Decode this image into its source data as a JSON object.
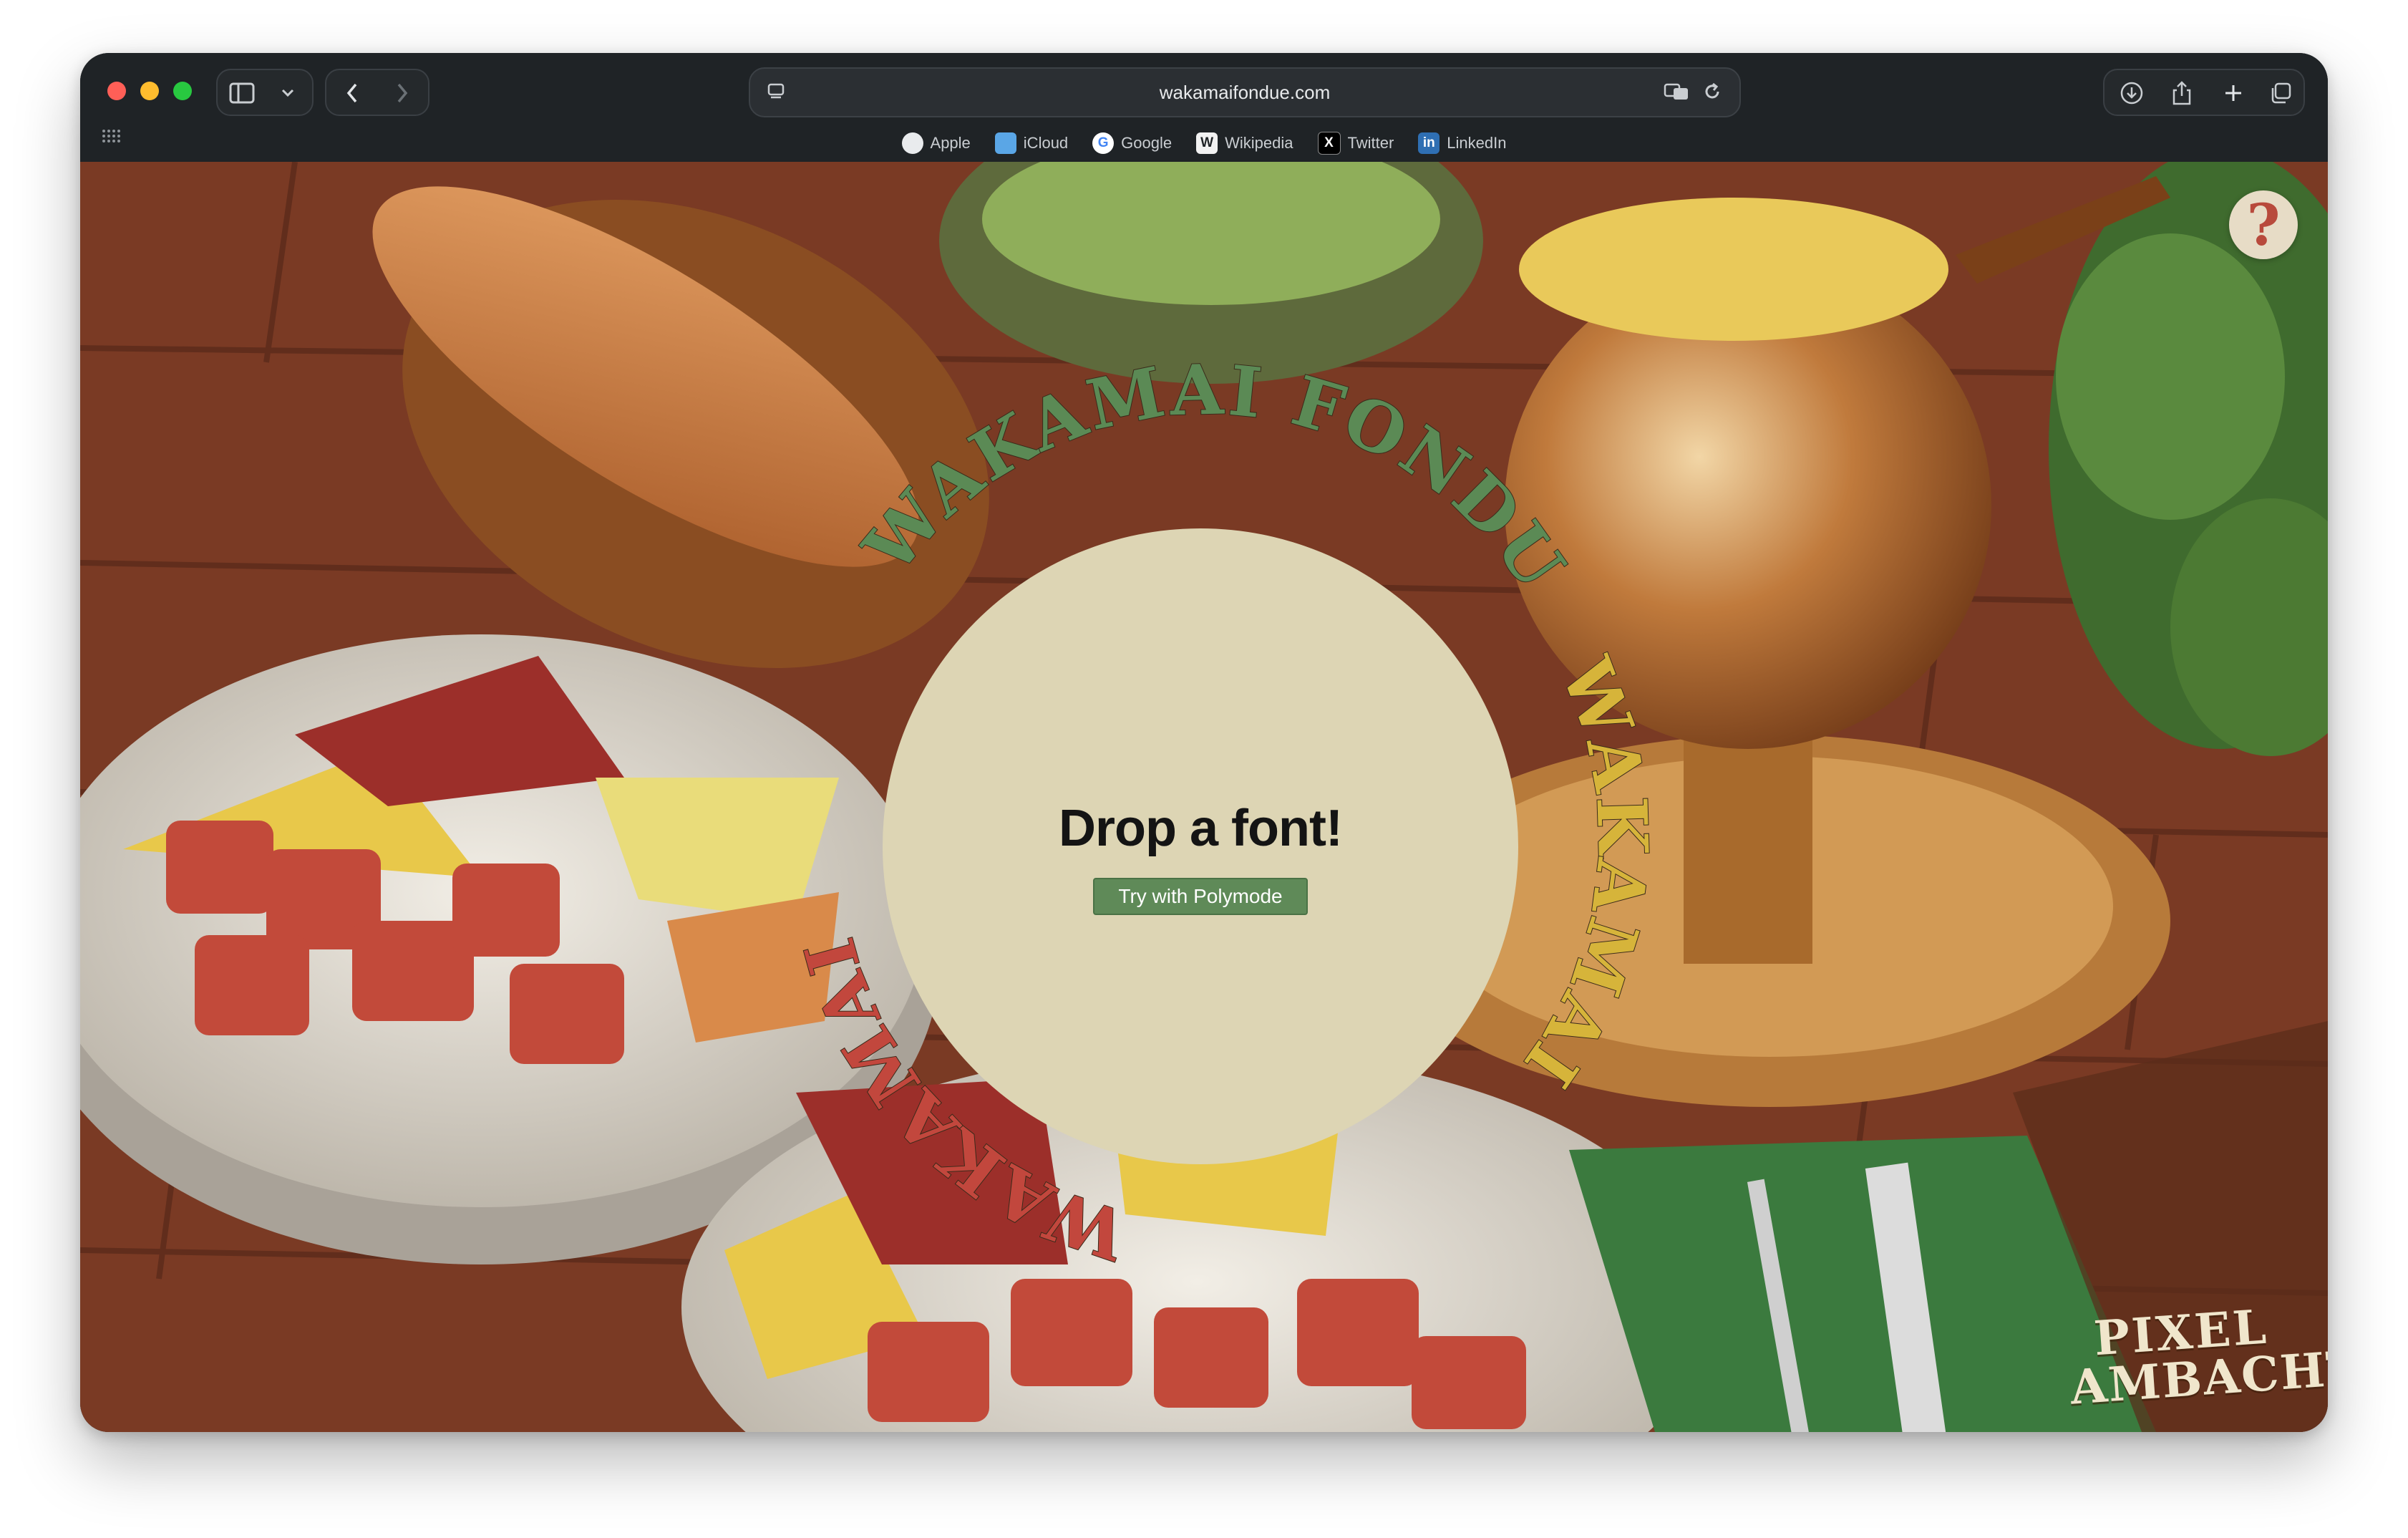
{
  "browser": {
    "url": "wakamaifondue.com",
    "favorites": [
      {
        "label": "Apple",
        "icon": "apple-icon"
      },
      {
        "label": "iCloud",
        "icon": "icloud-icon"
      },
      {
        "label": "Google",
        "icon": "google-icon"
      },
      {
        "label": "Wikipedia",
        "icon": "wikipedia-icon"
      },
      {
        "label": "Twitter",
        "icon": "twitter-icon"
      },
      {
        "label": "LinkedIn",
        "icon": "linkedin-icon"
      }
    ]
  },
  "page": {
    "brand_ring": "WAKAMAI FONDUE",
    "title": "Drop a font!",
    "try_button": "Try with Polymode",
    "help_label": "?",
    "logo_line1": "PIXEL",
    "logo_line2": "AMBACHT"
  },
  "colors": {
    "ring_green": "#5b8a55",
    "ring_red": "#c2473d",
    "ring_yellow": "#d6b43a",
    "disc": "#ddd5b4",
    "button": "#5f8a58"
  }
}
